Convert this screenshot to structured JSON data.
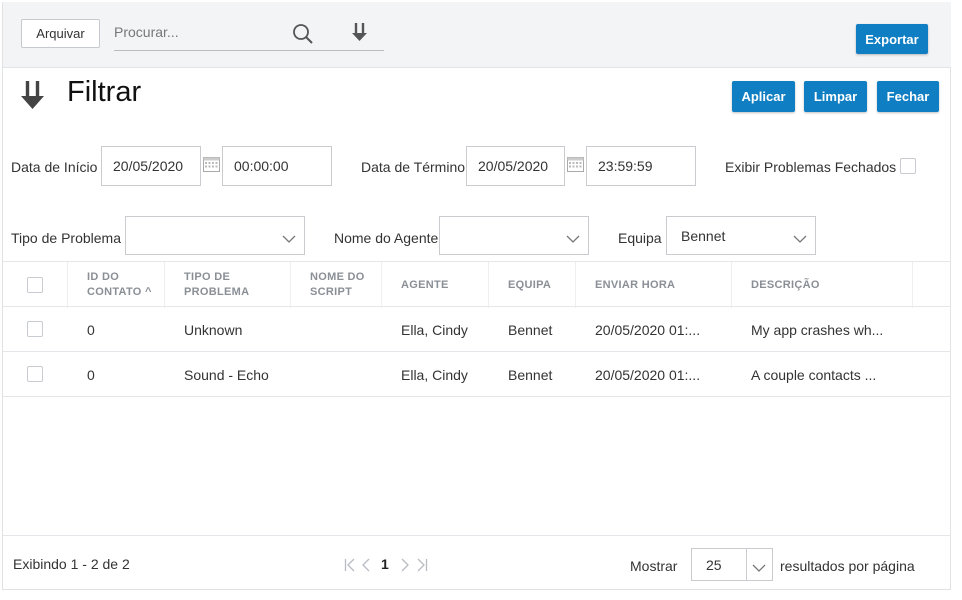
{
  "toolbar": {
    "archive_label": "Arquivar",
    "search_placeholder": "Procurar...",
    "export_label": "Exportar"
  },
  "filter": {
    "title": "Filtrar",
    "apply_label": "Aplicar",
    "clear_label": "Limpar",
    "close_label": "Fechar",
    "start_date_label": "Data de Início",
    "start_date": "20/05/2020",
    "start_time": "00:00:00",
    "end_date_label": "Data de Término",
    "end_date": "20/05/2020",
    "end_time": "23:59:59",
    "show_closed_label": "Exibir Problemas Fechados",
    "problem_type_label": "Tipo de Problema",
    "problem_type_value": "",
    "agent_name_label": "Nome do Agente",
    "agent_name_value": "",
    "team_label": "Equipa",
    "team_value": "Bennet"
  },
  "table": {
    "columns": [
      {
        "line1": "ID DO",
        "line2": "CONTATO ^"
      },
      {
        "line1": "TIPO DE",
        "line2": "PROBLEMA"
      },
      {
        "line1": "NOME DO",
        "line2": "SCRIPT"
      },
      {
        "line1": "AGENTE",
        "line2": ""
      },
      {
        "line1": "EQUIPA",
        "line2": ""
      },
      {
        "line1": "ENVIAR HORA",
        "line2": ""
      },
      {
        "line1": "DESCRIÇÃO",
        "line2": ""
      }
    ],
    "rows": [
      {
        "id": "0",
        "type": "Unknown",
        "script": "",
        "agent": "Ella, Cindy",
        "team": "Bennet",
        "time": "20/05/2020 01:...",
        "description": "My app crashes wh..."
      },
      {
        "id": "0",
        "type": "Sound - Echo",
        "script": "",
        "agent": "Ella, Cindy",
        "team": "Bennet",
        "time": "20/05/2020 01:...",
        "description": "A couple contacts ..."
      }
    ]
  },
  "footer": {
    "showing": "Exibindo 1 - 2 de 2",
    "current_page": "1",
    "show_label": "Mostrar",
    "page_size": "25",
    "per_page_label": "resultados por página"
  },
  "colors": {
    "accent": "#0f7ec2",
    "toolbar_bg": "#f3f4f6",
    "header_text": "#8a8f96"
  },
  "icons": [
    "search-icon",
    "filter-icon",
    "calendar-icon",
    "chevron-down-icon",
    "first-page-icon",
    "prev-page-icon",
    "next-page-icon",
    "last-page-icon"
  ]
}
